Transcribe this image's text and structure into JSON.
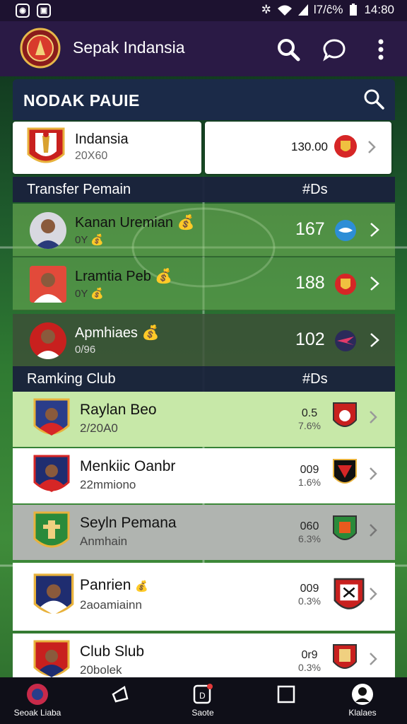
{
  "status": {
    "right_text": "Ɩ7/ĉ% ▮ 14:80",
    "battery": "Ɩ7/ĉ%",
    "time": "14:80"
  },
  "appbar": {
    "title": "Sepak Indansia"
  },
  "panel": {
    "title": "NODAK PAUIE"
  },
  "featured": {
    "team_name": "Indansia",
    "team_sub": "20X60",
    "value": "130.00"
  },
  "transfers": {
    "title": "Transfer Pemain",
    "column": "#Ds",
    "rows": [
      {
        "name": "Kanan Uremian",
        "sub": "0Y",
        "value": "167"
      },
      {
        "name": "Lramtia Peb",
        "sub": "0Y",
        "value": "188"
      },
      {
        "name": "Apmhiaes",
        "sub": "0/96",
        "value": "102"
      }
    ]
  },
  "ranking": {
    "title": "Ramking Club",
    "column": "#Ds",
    "rows": [
      {
        "name": "Raylan Beo",
        "sub": "2/20A0",
        "value": "0.5",
        "pct": "7.6%"
      },
      {
        "name": "Menkiic Oanbr",
        "sub": "22mmiono",
        "value": "009",
        "pct": "1.6%"
      },
      {
        "name": "Seyln Pemana",
        "sub": "Anmhain",
        "value": "060",
        "pct": "6.3%"
      },
      {
        "name": "Panrien",
        "sub": "2aoamiainn",
        "value": "009",
        "pct": "0.3%"
      },
      {
        "name": "Club Slub",
        "sub": "20bolek",
        "value": "0r9",
        "pct": "0.3%"
      }
    ]
  },
  "nav": {
    "items": [
      {
        "label": "Seoak Liaba"
      },
      {
        "label": ""
      },
      {
        "label": "Saote"
      },
      {
        "label": ""
      },
      {
        "label": "Klalaes"
      }
    ]
  }
}
